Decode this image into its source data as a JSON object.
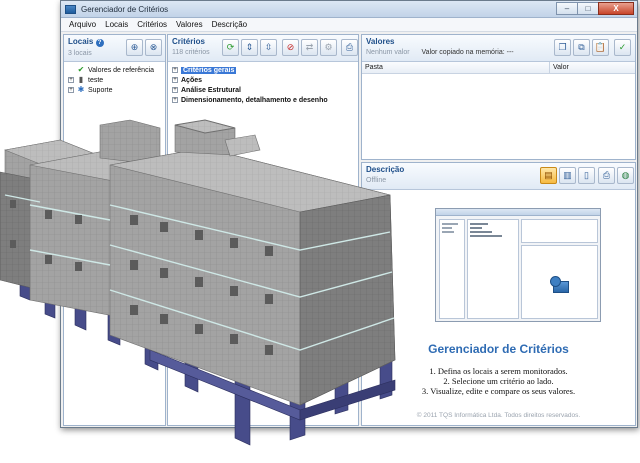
{
  "window": {
    "title": "Gerenciador de Critérios",
    "controls": {
      "minimize": "–",
      "maximize": "□",
      "close": "X"
    }
  },
  "menu": [
    "Arquivo",
    "Locais",
    "Critérios",
    "Valores",
    "Descrição"
  ],
  "locais": {
    "title": "Locais",
    "count": "3 locais",
    "tree": [
      {
        "label": "Valores de referência",
        "icon": "check-icon",
        "expander": ""
      },
      {
        "label": "teste",
        "icon": "building-icon",
        "expander": "+"
      },
      {
        "label": "Suporte",
        "icon": "gear-icon",
        "expander": "+"
      }
    ]
  },
  "criterios": {
    "title": "Critérios",
    "count": "118 critérios",
    "tree": [
      {
        "label": "Critérios gerais",
        "selected": true
      },
      {
        "label": "Ações",
        "selected": false
      },
      {
        "label": "Análise Estrutural",
        "selected": false
      },
      {
        "label": "Dimensionamento, detalhamento e desenho",
        "selected": false
      }
    ]
  },
  "valores": {
    "title": "Valores",
    "status": "Nenhum valor",
    "clipboard": "Valor copiado na memória: ---",
    "columns": [
      "Pasta",
      "Valor"
    ]
  },
  "descricao": {
    "title": "Descrição",
    "status": "Offline",
    "heading": "Gerenciador de Critérios",
    "steps": [
      "1. Defina os locais a serem monitorados.",
      "2. Selecione um critério ao lado.",
      "3. Visualize, edite e compare os seus valores."
    ],
    "copyright": "© 2011 TQS Informática Ltda. Todos direitos reservados."
  },
  "colors": {
    "accent": "#2e6bb3",
    "panel_border": "#9fb3cc",
    "selection": "#3a78d6",
    "building_wall": "#9a9a9a",
    "building_column": "#4a4f8f"
  }
}
